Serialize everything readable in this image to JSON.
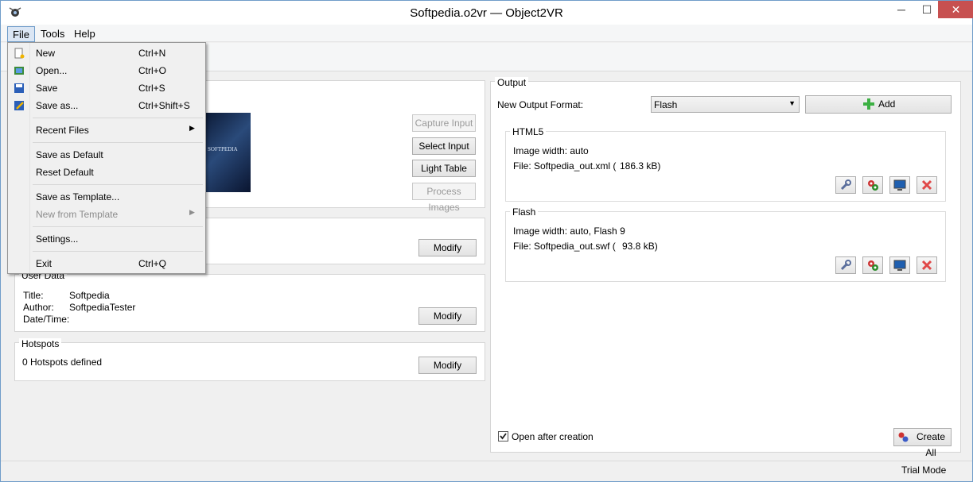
{
  "window": {
    "title": "Softpedia.o2vr — Object2VR",
    "min": "─",
    "max": "☐",
    "close": "✕"
  },
  "menubar": {
    "file": "File",
    "tools": "Tools",
    "help": "Help"
  },
  "file_menu": {
    "new": {
      "label": "New",
      "shortcut": "Ctrl+N"
    },
    "open": {
      "label": "Open...",
      "shortcut": "Ctrl+O"
    },
    "save": {
      "label": "Save",
      "shortcut": "Ctrl+S"
    },
    "save_as": {
      "label": "Save as...",
      "shortcut": "Ctrl+Shift+S"
    },
    "recent_files": "Recent Files",
    "save_default": "Save as Default",
    "reset_default": "Reset Default",
    "save_template": "Save as Template...",
    "new_template": "New from Template",
    "settings": "Settings...",
    "exit": {
      "label": "Exit",
      "shortcut": "Ctrl+Q"
    }
  },
  "input": {
    "capture": "Capture Input",
    "select": "Select Input",
    "light_table": "Light Table",
    "process": "Process Images",
    "thumb_text": "SOFTPEDIA"
  },
  "viewing": {
    "modify": "Modify"
  },
  "user_data": {
    "label": "User Data",
    "title_label": "Title:",
    "title_value": "Softpedia",
    "author_label": "Author:",
    "author_value": "SoftpediaTester",
    "date_label": "Date/Time:",
    "modify": "Modify"
  },
  "hotspots": {
    "label": "Hotspots",
    "count_text": "0 Hotspots defined",
    "modify": "Modify"
  },
  "output": {
    "label": "Output",
    "format_label": "New Output Format:",
    "format_value": "Flash",
    "add": "Add",
    "html5": {
      "label": "HTML5",
      "width": "Image width: auto",
      "file": "File: Softpedia_out.xml (",
      "size": "186.3 kB)"
    },
    "flash": {
      "label": "Flash",
      "width": "Image width: auto, Flash 9",
      "file": "File: Softpedia_out.swf (",
      "size": "93.8 kB)"
    },
    "open_after": "Open after creation",
    "create_all": "Create All"
  },
  "status": {
    "mode": "Trial Mode"
  },
  "colors": {
    "accent": "#6f9cc9",
    "close_red": "#c75050",
    "add_green": "#3cb043"
  }
}
